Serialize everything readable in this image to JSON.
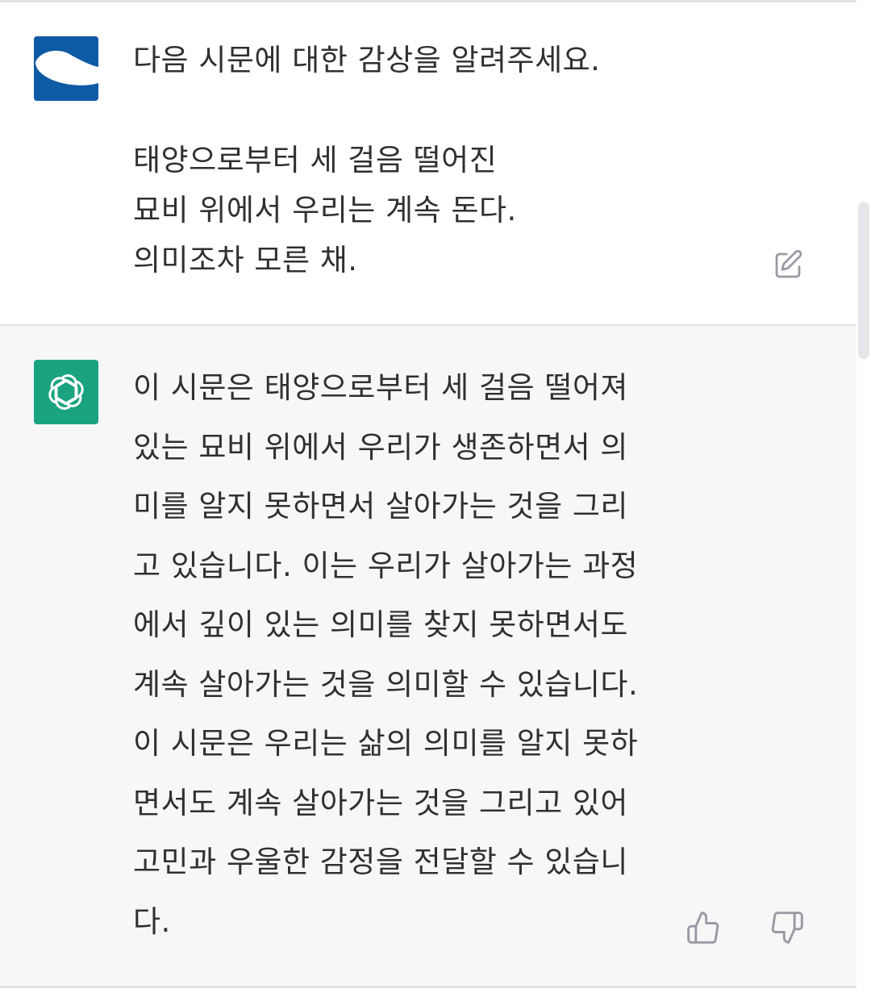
{
  "colors": {
    "user_bg": "#ffffff",
    "assistant_bg": "#f7f7f8",
    "user_avatar": "#0f5aa5",
    "gpt_avatar": "#1aa37f",
    "text": "#303030",
    "icon": "#9a9aa4"
  },
  "user_message": {
    "avatar_icon": "user-avatar",
    "lines": [
      "다음 시문에 대한 감상을 알려주세요.",
      "",
      "태양으로부터 세 걸음 떨어진",
      "묘비 위에서 우리는 계속 돈다.",
      "의미조차 모른 채."
    ],
    "edit_icon": "edit-icon"
  },
  "assistant_message": {
    "avatar_icon": "openai-logo-icon",
    "lines": [
      "이 시문은 태양으로부터 세 걸음 떨어져",
      "있는 묘비 위에서 우리가 생존하면서 의",
      "미를 알지 못하면서 살아가는 것을 그리",
      "고 있습니다. 이는 우리가 살아가는 과정",
      "에서 깊이 있는 의미를 찾지 못하면서도",
      "계속 살아가는 것을 의미할 수 있습니다.",
      "이 시문은 우리는 삶의 의미를 알지 못하",
      "면서도 계속 살아가는 것을 그리고 있어",
      "고민과 우울한 감정을 전달할 수 있습니",
      "다."
    ],
    "like_icon": "thumbs-up-icon",
    "dislike_icon": "thumbs-down-icon"
  }
}
